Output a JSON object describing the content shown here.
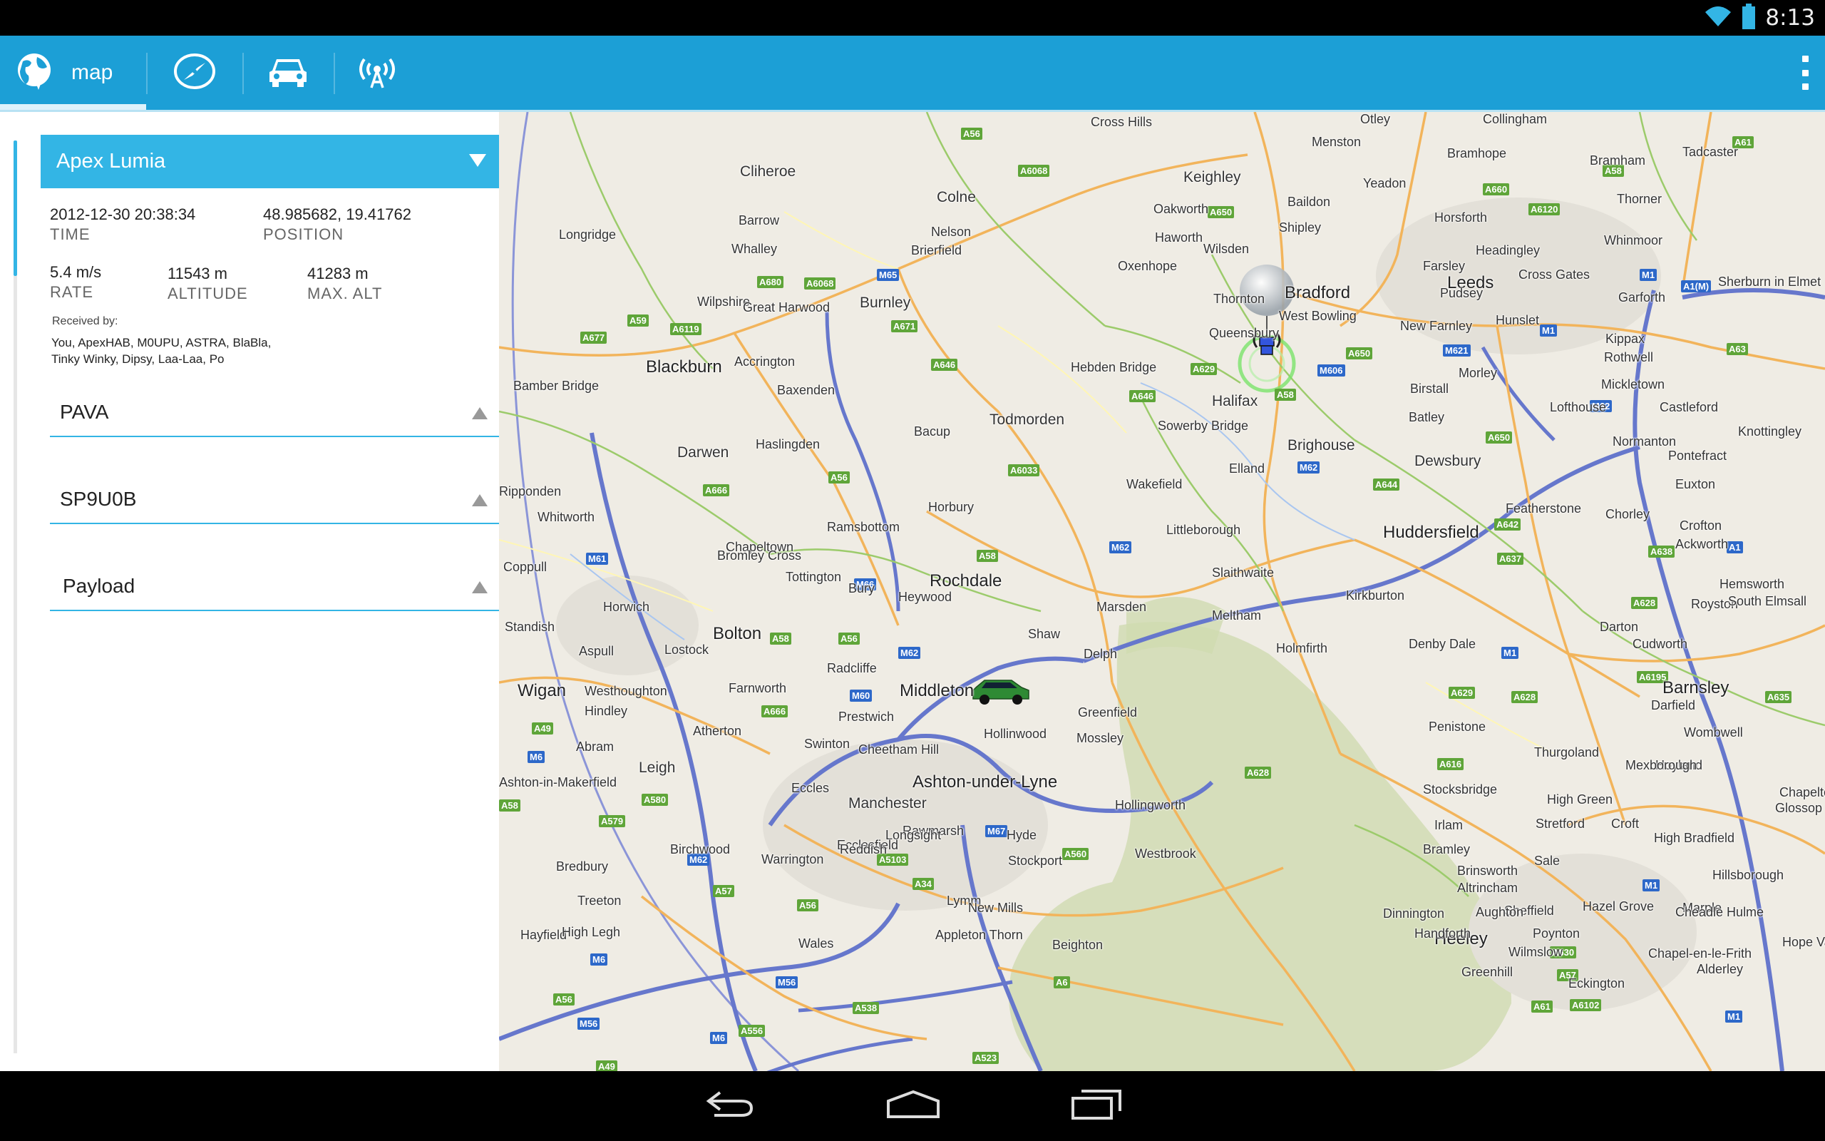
{
  "status_bar": {
    "time": "8:13"
  },
  "action_bar": {
    "tabs": [
      {
        "label": "map",
        "icon": "globe-icon",
        "selected": true
      },
      {
        "icon": "compass-icon"
      },
      {
        "icon": "car-icon"
      },
      {
        "icon": "radio-signal-icon"
      }
    ]
  },
  "payload": {
    "name": "Apex Lumia",
    "time_value": "2012-12-30  20:38:34",
    "time_label": "TIME",
    "position_value": "48.985682,  19.41762",
    "position_label": "POSITION",
    "rate_value": "5.4 m/s",
    "rate_label": "RATE",
    "altitude_value": "11543 m",
    "altitude_label": "ALTITUDE",
    "max_alt_value": "41283 m",
    "max_alt_label": "MAX. ALT",
    "received_label": "Received by:",
    "received_line1": "You,  ApexHAB,  M0UPU,  ASTRA,  BlaBla,",
    "received_line2": "Tinky Winky,  Dipsy,  Laa-Laa,  Po"
  },
  "collapsed_items": [
    {
      "label": "PAVA"
    },
    {
      "label": "SP9U0B"
    },
    {
      "label": "Payload"
    }
  ],
  "map": {
    "places": [
      {
        "name": "Otley"
      },
      {
        "name": "Cross Hills"
      },
      {
        "name": "Menston"
      },
      {
        "name": "Bramhope"
      },
      {
        "name": "Collingham"
      },
      {
        "name": "Tadcaster"
      },
      {
        "name": "Bramham"
      },
      {
        "name": "Cliheroe"
      },
      {
        "name": "Keighley"
      },
      {
        "name": "Yeadon"
      },
      {
        "name": "Colne"
      },
      {
        "name": "Baildon"
      },
      {
        "name": "Thorner"
      },
      {
        "name": "Barrow"
      },
      {
        "name": "Oakworth"
      },
      {
        "name": "Horsforth"
      },
      {
        "name": "Shipley"
      },
      {
        "name": "Longridge"
      },
      {
        "name": "Nelson"
      },
      {
        "name": "Whinmoor"
      },
      {
        "name": "Whalley"
      },
      {
        "name": "Brierfield"
      },
      {
        "name": "Haworth"
      },
      {
        "name": "Wilsden"
      },
      {
        "name": "Headingley"
      },
      {
        "name": "Oxenhope"
      },
      {
        "name": "Farsley"
      },
      {
        "name": "Cross Gates"
      },
      {
        "name": "Bradford"
      },
      {
        "name": "Leeds"
      },
      {
        "name": "Sherburn in Elmet"
      },
      {
        "name": "Wilpshire"
      },
      {
        "name": "Great Harwood"
      },
      {
        "name": "Burnley"
      },
      {
        "name": "Thornton"
      },
      {
        "name": "Pudsey"
      },
      {
        "name": "Garforth"
      },
      {
        "name": "West Bowling"
      },
      {
        "name": "Hunslet"
      },
      {
        "name": "New Farnley"
      },
      {
        "name": "Queensbury"
      },
      {
        "name": "Kippax"
      },
      {
        "name": "Accrington"
      },
      {
        "name": "Blackburn"
      },
      {
        "name": "Rothwell"
      },
      {
        "name": "Hebden Bridge"
      },
      {
        "name": "Morley"
      },
      {
        "name": "Mickletown"
      },
      {
        "name": "Bamber Bridge"
      },
      {
        "name": "Baxenden"
      },
      {
        "name": "Halifax"
      },
      {
        "name": "Birstall"
      },
      {
        "name": "Lofthouse"
      },
      {
        "name": "Castleford"
      },
      {
        "name": "Todmorden"
      },
      {
        "name": "Batley"
      },
      {
        "name": "Knottingley"
      },
      {
        "name": "Sowerby Bridge"
      },
      {
        "name": "Darwen"
      },
      {
        "name": "Bacup"
      },
      {
        "name": "Brighouse"
      },
      {
        "name": "Normanton"
      },
      {
        "name": "Haslingden"
      },
      {
        "name": "Dewsbury"
      },
      {
        "name": "Pontefract"
      },
      {
        "name": "Elland"
      },
      {
        "name": "Wakefield"
      },
      {
        "name": "Euxton"
      },
      {
        "name": "Ripponden"
      },
      {
        "name": "Featherstone"
      },
      {
        "name": "Chorley"
      },
      {
        "name": "Whitworth"
      },
      {
        "name": "Horbury"
      },
      {
        "name": "Crofton"
      },
      {
        "name": "Ramsbottom"
      },
      {
        "name": "Littleborough"
      },
      {
        "name": "Huddersfield"
      },
      {
        "name": "Ackworth"
      },
      {
        "name": "Chapeltown"
      },
      {
        "name": "Coppull"
      },
      {
        "name": "Bromley Cross"
      },
      {
        "name": "Tottington"
      },
      {
        "name": "Rochdale"
      },
      {
        "name": "Slaithwaite"
      },
      {
        "name": "Hemsworth"
      },
      {
        "name": "Horwich"
      },
      {
        "name": "Bury"
      },
      {
        "name": "Heywood"
      },
      {
        "name": "Kirkburton"
      },
      {
        "name": "Marsden"
      },
      {
        "name": "Royston"
      },
      {
        "name": "South Elmsall"
      },
      {
        "name": "Standish"
      },
      {
        "name": "Meltham"
      },
      {
        "name": "Bolton"
      },
      {
        "name": "Shaw"
      },
      {
        "name": "Darton"
      },
      {
        "name": "Aspull"
      },
      {
        "name": "Lostock"
      },
      {
        "name": "Denby Dale"
      },
      {
        "name": "Cudworth"
      },
      {
        "name": "Holmfirth"
      },
      {
        "name": "Delph"
      },
      {
        "name": "Radcliffe"
      },
      {
        "name": "Westhoughton"
      },
      {
        "name": "Wigan"
      },
      {
        "name": "Farnworth"
      },
      {
        "name": "Middleton"
      },
      {
        "name": "Barnsley"
      },
      {
        "name": "Hindley"
      },
      {
        "name": "Prestwich"
      },
      {
        "name": "Greenfield"
      },
      {
        "name": "Penistone"
      },
      {
        "name": "Darfield"
      },
      {
        "name": "Atherton"
      },
      {
        "name": "Hollinwood"
      },
      {
        "name": "Wombwell"
      },
      {
        "name": "Swinton"
      },
      {
        "name": "Mossley"
      },
      {
        "name": "Abram"
      },
      {
        "name": "Cheetham Hill"
      },
      {
        "name": "Thurgoland"
      },
      {
        "name": "Hoyland"
      },
      {
        "name": "Leigh"
      },
      {
        "name": "Ashton-under-Lyne"
      },
      {
        "name": "Mexborough"
      },
      {
        "name": "Ashton-in-Makerfield"
      },
      {
        "name": "Stocksbridge"
      },
      {
        "name": "Eccles"
      },
      {
        "name": "Manchester"
      },
      {
        "name": "High Green"
      },
      {
        "name": "Hollingworth"
      },
      {
        "name": "Chapeltown"
      },
      {
        "name": "Rawmarsh"
      },
      {
        "name": "Longsight"
      },
      {
        "name": "Hyde"
      },
      {
        "name": "Stretford"
      },
      {
        "name": "Glossop"
      },
      {
        "name": "Ecclesfield"
      },
      {
        "name": "Irlam"
      },
      {
        "name": "Croft"
      },
      {
        "name": "Reddish"
      },
      {
        "name": "High Bradfield"
      },
      {
        "name": "Bramley"
      },
      {
        "name": "Sale"
      },
      {
        "name": "Birchwood"
      },
      {
        "name": "Bredbury"
      },
      {
        "name": "Westbrook"
      },
      {
        "name": "Brinsworth"
      },
      {
        "name": "Hillsborough"
      },
      {
        "name": "Stockport"
      },
      {
        "name": "Warrington"
      },
      {
        "name": "Altrincham"
      },
      {
        "name": "Marple"
      },
      {
        "name": "Treeton"
      },
      {
        "name": "Lymm"
      },
      {
        "name": "Sheffield"
      },
      {
        "name": "Cheadle Hulme"
      },
      {
        "name": "Hazel Grove"
      },
      {
        "name": "Hayfield"
      },
      {
        "name": "Aughton"
      },
      {
        "name": "Dinnington"
      },
      {
        "name": "New Mills"
      },
      {
        "name": "Heeley"
      },
      {
        "name": "Appleton Thorn"
      },
      {
        "name": "High Legh"
      },
      {
        "name": "Handforth"
      },
      {
        "name": "Poynton"
      },
      {
        "name": "Hope Valley"
      },
      {
        "name": "Beighton"
      },
      {
        "name": "Wales"
      },
      {
        "name": "Wilmslow"
      },
      {
        "name": "Chapel-en-le-Frith"
      },
      {
        "name": "Greenhill"
      },
      {
        "name": "Alderley"
      },
      {
        "name": "Eckington"
      }
    ]
  }
}
